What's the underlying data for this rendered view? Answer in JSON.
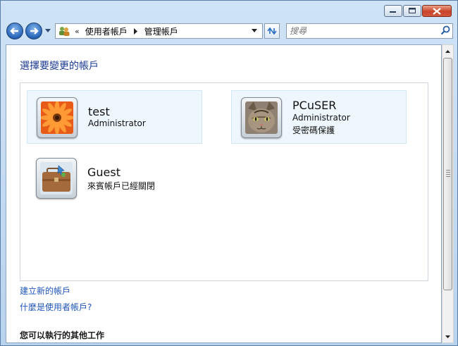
{
  "window": {
    "accent": "#1c3a92",
    "link_color": "#1f56b8"
  },
  "caption_buttons": [
    "minimize",
    "maximize",
    "close"
  ],
  "address_bar": {
    "icon": "user-accounts-icon",
    "overflow": "«",
    "crumbs": [
      "使用者帳戶",
      "管理帳戶"
    ]
  },
  "search": {
    "placeholder": "搜尋"
  },
  "page": {
    "heading": "選擇要變更的帳戶",
    "accounts": [
      {
        "name": "test",
        "line1": "Administrator",
        "line2": "",
        "picture": "flower-picture"
      },
      {
        "name": "PCuSER",
        "line1": "Administrator",
        "line2": "受密碼保護",
        "picture": "cat-picture"
      },
      {
        "name": "Guest",
        "line1": "來賓帳戶已經關閉",
        "line2": "",
        "picture": "briefcase-picture"
      }
    ],
    "links": [
      "建立新的帳戶",
      "什麼是使用者帳戶?"
    ],
    "other_tasks_title": "您可以執行的其他工作"
  }
}
